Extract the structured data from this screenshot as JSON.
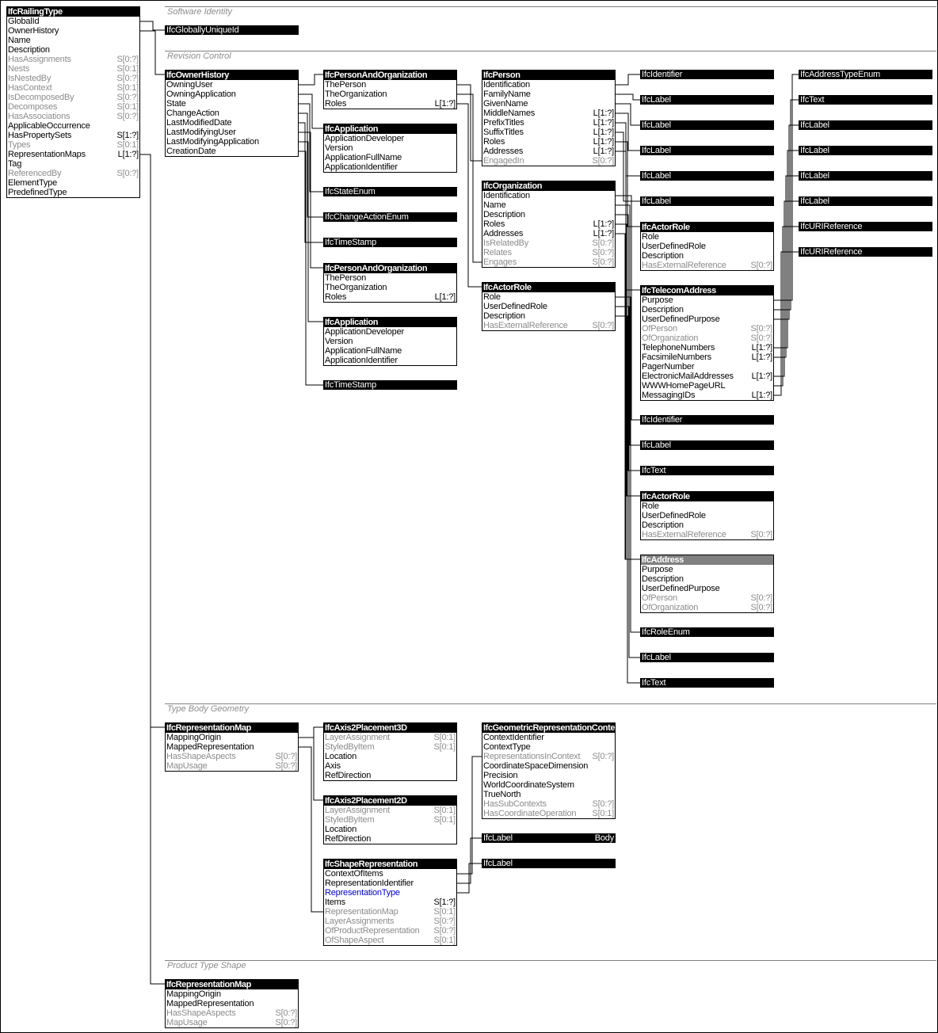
{
  "sections": [
    {
      "title": "Software Identity"
    },
    {
      "title": "Revision Control"
    },
    {
      "title": "Type Body Geometry"
    },
    {
      "title": "Product Type Shape"
    }
  ],
  "root": {
    "name": "IfcRailingType",
    "rows": [
      {
        "label": "GlobalId",
        "card": "",
        "inverse": false
      },
      {
        "label": "OwnerHistory",
        "card": "",
        "inverse": false
      },
      {
        "label": "Name",
        "card": "",
        "inverse": false
      },
      {
        "label": "Description",
        "card": "",
        "inverse": false
      },
      {
        "label": "HasAssignments",
        "card": "S[0:?]",
        "inverse": true
      },
      {
        "label": "Nests",
        "card": "S[0:1]",
        "inverse": true
      },
      {
        "label": "IsNestedBy",
        "card": "S[0:?]",
        "inverse": true
      },
      {
        "label": "HasContext",
        "card": "S[0:1]",
        "inverse": true
      },
      {
        "label": "IsDecomposedBy",
        "card": "S[0:?]",
        "inverse": true
      },
      {
        "label": "Decomposes",
        "card": "S[0:1]",
        "inverse": true
      },
      {
        "label": "HasAssociations",
        "card": "S[0:?]",
        "inverse": true
      },
      {
        "label": "ApplicableOccurrence",
        "card": "",
        "inverse": false
      },
      {
        "label": "HasPropertySets",
        "card": "S[1:?]",
        "inverse": false
      },
      {
        "label": "Types",
        "card": "S[0:1]",
        "inverse": true
      },
      {
        "label": "RepresentationMaps",
        "card": "L[1:?]",
        "inverse": false
      },
      {
        "label": "Tag",
        "card": "",
        "inverse": false
      },
      {
        "label": "ReferencedBy",
        "card": "S[0:?]",
        "inverse": true
      },
      {
        "label": "ElementType",
        "card": "",
        "inverse": false
      },
      {
        "label": "PredefinedType",
        "card": "",
        "inverse": false
      }
    ]
  },
  "entities": {
    "ownerHistory": {
      "name": "IfcOwnerHistory",
      "rows": [
        {
          "label": "OwningUser",
          "card": ""
        },
        {
          "label": "OwningApplication",
          "card": ""
        },
        {
          "label": "State",
          "card": ""
        },
        {
          "label": "ChangeAction",
          "card": ""
        },
        {
          "label": "LastModifiedDate",
          "card": ""
        },
        {
          "label": "LastModifyingUser",
          "card": ""
        },
        {
          "label": "LastModifyingApplication",
          "card": ""
        },
        {
          "label": "CreationDate",
          "card": ""
        }
      ]
    },
    "personAndOrg1": {
      "name": "IfcPersonAndOrganization",
      "rows": [
        {
          "label": "ThePerson",
          "card": ""
        },
        {
          "label": "TheOrganization",
          "card": ""
        },
        {
          "label": "Roles",
          "card": "L[1:?]"
        }
      ]
    },
    "application1": {
      "name": "IfcApplication",
      "rows": [
        {
          "label": "ApplicationDeveloper",
          "card": ""
        },
        {
          "label": "Version",
          "card": ""
        },
        {
          "label": "ApplicationFullName",
          "card": ""
        },
        {
          "label": "ApplicationIdentifier",
          "card": ""
        }
      ]
    },
    "personAndOrg2": {
      "name": "IfcPersonAndOrganization",
      "rows": [
        {
          "label": "ThePerson",
          "card": ""
        },
        {
          "label": "TheOrganization",
          "card": ""
        },
        {
          "label": "Roles",
          "card": "L[1:?]"
        }
      ]
    },
    "application2": {
      "name": "IfcApplication",
      "rows": [
        {
          "label": "ApplicationDeveloper",
          "card": ""
        },
        {
          "label": "Version",
          "card": ""
        },
        {
          "label": "ApplicationFullName",
          "card": ""
        },
        {
          "label": "ApplicationIdentifier",
          "card": ""
        }
      ]
    },
    "person": {
      "name": "IfcPerson",
      "rows": [
        {
          "label": "Identification",
          "card": ""
        },
        {
          "label": "FamilyName",
          "card": ""
        },
        {
          "label": "GivenName",
          "card": ""
        },
        {
          "label": "MiddleNames",
          "card": "L[1:?]"
        },
        {
          "label": "PrefixTitles",
          "card": "L[1:?]"
        },
        {
          "label": "SuffixTitles",
          "card": "L[1:?]"
        },
        {
          "label": "Roles",
          "card": "L[1:?]"
        },
        {
          "label": "Addresses",
          "card": "L[1:?]"
        },
        {
          "label": "EngagedIn",
          "card": "S[0:?]",
          "inverse": true
        }
      ]
    },
    "organization": {
      "name": "IfcOrganization",
      "rows": [
        {
          "label": "Identification",
          "card": ""
        },
        {
          "label": "Name",
          "card": ""
        },
        {
          "label": "Description",
          "card": ""
        },
        {
          "label": "Roles",
          "card": "L[1:?]"
        },
        {
          "label": "Addresses",
          "card": "L[1:?]"
        },
        {
          "label": "IsRelatedBy",
          "card": "S[0:?]",
          "inverse": true
        },
        {
          "label": "Relates",
          "card": "S[0:?]",
          "inverse": true
        },
        {
          "label": "Engages",
          "card": "S[0:?]",
          "inverse": true
        }
      ]
    },
    "actorRole1": {
      "name": "IfcActorRole",
      "rows": [
        {
          "label": "Role",
          "card": ""
        },
        {
          "label": "UserDefinedRole",
          "card": ""
        },
        {
          "label": "Description",
          "card": ""
        },
        {
          "label": "HasExternalReference",
          "card": "S[0:?]",
          "inverse": true
        }
      ]
    },
    "actorRole2": {
      "name": "IfcActorRole",
      "rows": [
        {
          "label": "Role",
          "card": ""
        },
        {
          "label": "UserDefinedRole",
          "card": ""
        },
        {
          "label": "Description",
          "card": ""
        },
        {
          "label": "HasExternalReference",
          "card": "S[0:?]",
          "inverse": true
        }
      ]
    },
    "telecom": {
      "name": "IfcTelecomAddress",
      "rows": [
        {
          "label": "Purpose",
          "card": ""
        },
        {
          "label": "Description",
          "card": ""
        },
        {
          "label": "UserDefinedPurpose",
          "card": ""
        },
        {
          "label": "OfPerson",
          "card": "S[0:?]",
          "inverse": true
        },
        {
          "label": "OfOrganization",
          "card": "S[0:?]",
          "inverse": true
        },
        {
          "label": "TelephoneNumbers",
          "card": "L[1:?]"
        },
        {
          "label": "FacsimileNumbers",
          "card": "L[1:?]"
        },
        {
          "label": "PagerNumber",
          "card": ""
        },
        {
          "label": "ElectronicMailAddresses",
          "card": "L[1:?]"
        },
        {
          "label": "WWWHomePageURL",
          "card": ""
        },
        {
          "label": "MessagingIDs",
          "card": "L[1:?]"
        }
      ]
    },
    "actorRole3": {
      "name": "IfcActorRole",
      "rows": [
        {
          "label": "Role",
          "card": ""
        },
        {
          "label": "UserDefinedRole",
          "card": ""
        },
        {
          "label": "Description",
          "card": ""
        },
        {
          "label": "HasExternalReference",
          "card": "S[0:?]",
          "inverse": true
        }
      ]
    },
    "address": {
      "name": "IfcAddress",
      "abstract": true,
      "rows": [
        {
          "label": "Purpose",
          "card": ""
        },
        {
          "label": "Description",
          "card": ""
        },
        {
          "label": "UserDefinedPurpose",
          "card": ""
        },
        {
          "label": "OfPerson",
          "card": "S[0:?]",
          "inverse": true
        },
        {
          "label": "OfOrganization",
          "card": "S[0:?]",
          "inverse": true
        }
      ]
    },
    "repMap1": {
      "name": "IfcRepresentationMap",
      "rows": [
        {
          "label": "MappingOrigin",
          "card": ""
        },
        {
          "label": "MappedRepresentation",
          "card": ""
        },
        {
          "label": "HasShapeAspects",
          "card": "S[0:?]",
          "inverse": true
        },
        {
          "label": "MapUsage",
          "card": "S[0:?]",
          "inverse": true
        }
      ]
    },
    "axis3d": {
      "name": "IfcAxis2Placement3D",
      "rows": [
        {
          "label": "LayerAssignment",
          "card": "S[0:1]",
          "inverse": true
        },
        {
          "label": "StyledByItem",
          "card": "S[0:1]",
          "inverse": true
        },
        {
          "label": "Location",
          "card": ""
        },
        {
          "label": "Axis",
          "card": ""
        },
        {
          "label": "RefDirection",
          "card": ""
        }
      ]
    },
    "axis2d": {
      "name": "IfcAxis2Placement2D",
      "rows": [
        {
          "label": "LayerAssignment",
          "card": "S[0:1]",
          "inverse": true
        },
        {
          "label": "StyledByItem",
          "card": "S[0:1]",
          "inverse": true
        },
        {
          "label": "Location",
          "card": ""
        },
        {
          "label": "RefDirection",
          "card": ""
        }
      ]
    },
    "shapeRep": {
      "name": "IfcShapeRepresentation",
      "rows": [
        {
          "label": "ContextOfItems",
          "card": ""
        },
        {
          "label": "RepresentationIdentifier",
          "card": ""
        },
        {
          "label": "RepresentationType",
          "card": "",
          "selected": true
        },
        {
          "label": "Items",
          "card": "S[1:?]"
        },
        {
          "label": "RepresentationMap",
          "card": "S[0:1]",
          "inverse": true
        },
        {
          "label": "LayerAssignments",
          "card": "S[0:?]",
          "inverse": true
        },
        {
          "label": "OfProductRepresentation",
          "card": "S[0:?]",
          "inverse": true
        },
        {
          "label": "OfShapeAspect",
          "card": "S[0:1]",
          "inverse": true
        }
      ]
    },
    "geomContext": {
      "name": "IfcGeometricRepresentationContext",
      "rows": [
        {
          "label": "ContextIdentifier",
          "card": ""
        },
        {
          "label": "ContextType",
          "card": ""
        },
        {
          "label": "RepresentationsInContext",
          "card": "S[0:?]",
          "inverse": true
        },
        {
          "label": "CoordinateSpaceDimension",
          "card": ""
        },
        {
          "label": "Precision",
          "card": ""
        },
        {
          "label": "WorldCoordinateSystem",
          "card": ""
        },
        {
          "label": "TrueNorth",
          "card": ""
        },
        {
          "label": "HasSubContexts",
          "card": "S[0:?]",
          "inverse": true
        },
        {
          "label": "HasCoordinateOperation",
          "card": "S[0:1]",
          "inverse": true
        }
      ]
    },
    "repMap2": {
      "name": "IfcRepresentationMap",
      "rows": [
        {
          "label": "MappingOrigin",
          "card": ""
        },
        {
          "label": "MappedRepresentation",
          "card": ""
        },
        {
          "label": "HasShapeAspects",
          "card": "S[0:?]",
          "inverse": true
        },
        {
          "label": "MapUsage",
          "card": "S[0:?]",
          "inverse": true
        }
      ]
    }
  },
  "types": {
    "globallyUniqueId": {
      "name": "IfcGloballyUniqueId",
      "value": ""
    },
    "stateEnum": {
      "name": "IfcStateEnum",
      "value": ""
    },
    "changeActionEnum": {
      "name": "IfcChangeActionEnum",
      "value": ""
    },
    "timeStamp1": {
      "name": "IfcTimeStamp",
      "value": ""
    },
    "timeStamp2": {
      "name": "IfcTimeStamp",
      "value": ""
    },
    "p_identifier": {
      "name": "IfcIdentifier",
      "value": ""
    },
    "p_label1": {
      "name": "IfcLabel",
      "value": ""
    },
    "p_label2": {
      "name": "IfcLabel",
      "value": ""
    },
    "p_label3": {
      "name": "IfcLabel",
      "value": ""
    },
    "p_label4": {
      "name": "IfcLabel",
      "value": ""
    },
    "p_label5": {
      "name": "IfcLabel",
      "value": ""
    },
    "o_identifier": {
      "name": "IfcIdentifier",
      "value": ""
    },
    "o_label": {
      "name": "IfcLabel",
      "value": ""
    },
    "o_text": {
      "name": "IfcText",
      "value": ""
    },
    "roleEnum": {
      "name": "IfcRoleEnum",
      "value": ""
    },
    "r_label": {
      "name": "IfcLabel",
      "value": ""
    },
    "r_text": {
      "name": "IfcText",
      "value": ""
    },
    "t_addressTypeEnum": {
      "name": "IfcAddressTypeEnum",
      "value": ""
    },
    "t_text": {
      "name": "IfcText",
      "value": ""
    },
    "t_label1": {
      "name": "IfcLabel",
      "value": ""
    },
    "t_label2": {
      "name": "IfcLabel",
      "value": ""
    },
    "t_label3": {
      "name": "IfcLabel",
      "value": ""
    },
    "t_label4": {
      "name": "IfcLabel",
      "value": ""
    },
    "t_uri1": {
      "name": "IfcURIReference",
      "value": ""
    },
    "t_uri2": {
      "name": "IfcURIReference",
      "value": ""
    },
    "s_label1": {
      "name": "IfcLabel",
      "value": "Body"
    },
    "s_label2": {
      "name": "IfcLabel",
      "value": ""
    }
  }
}
